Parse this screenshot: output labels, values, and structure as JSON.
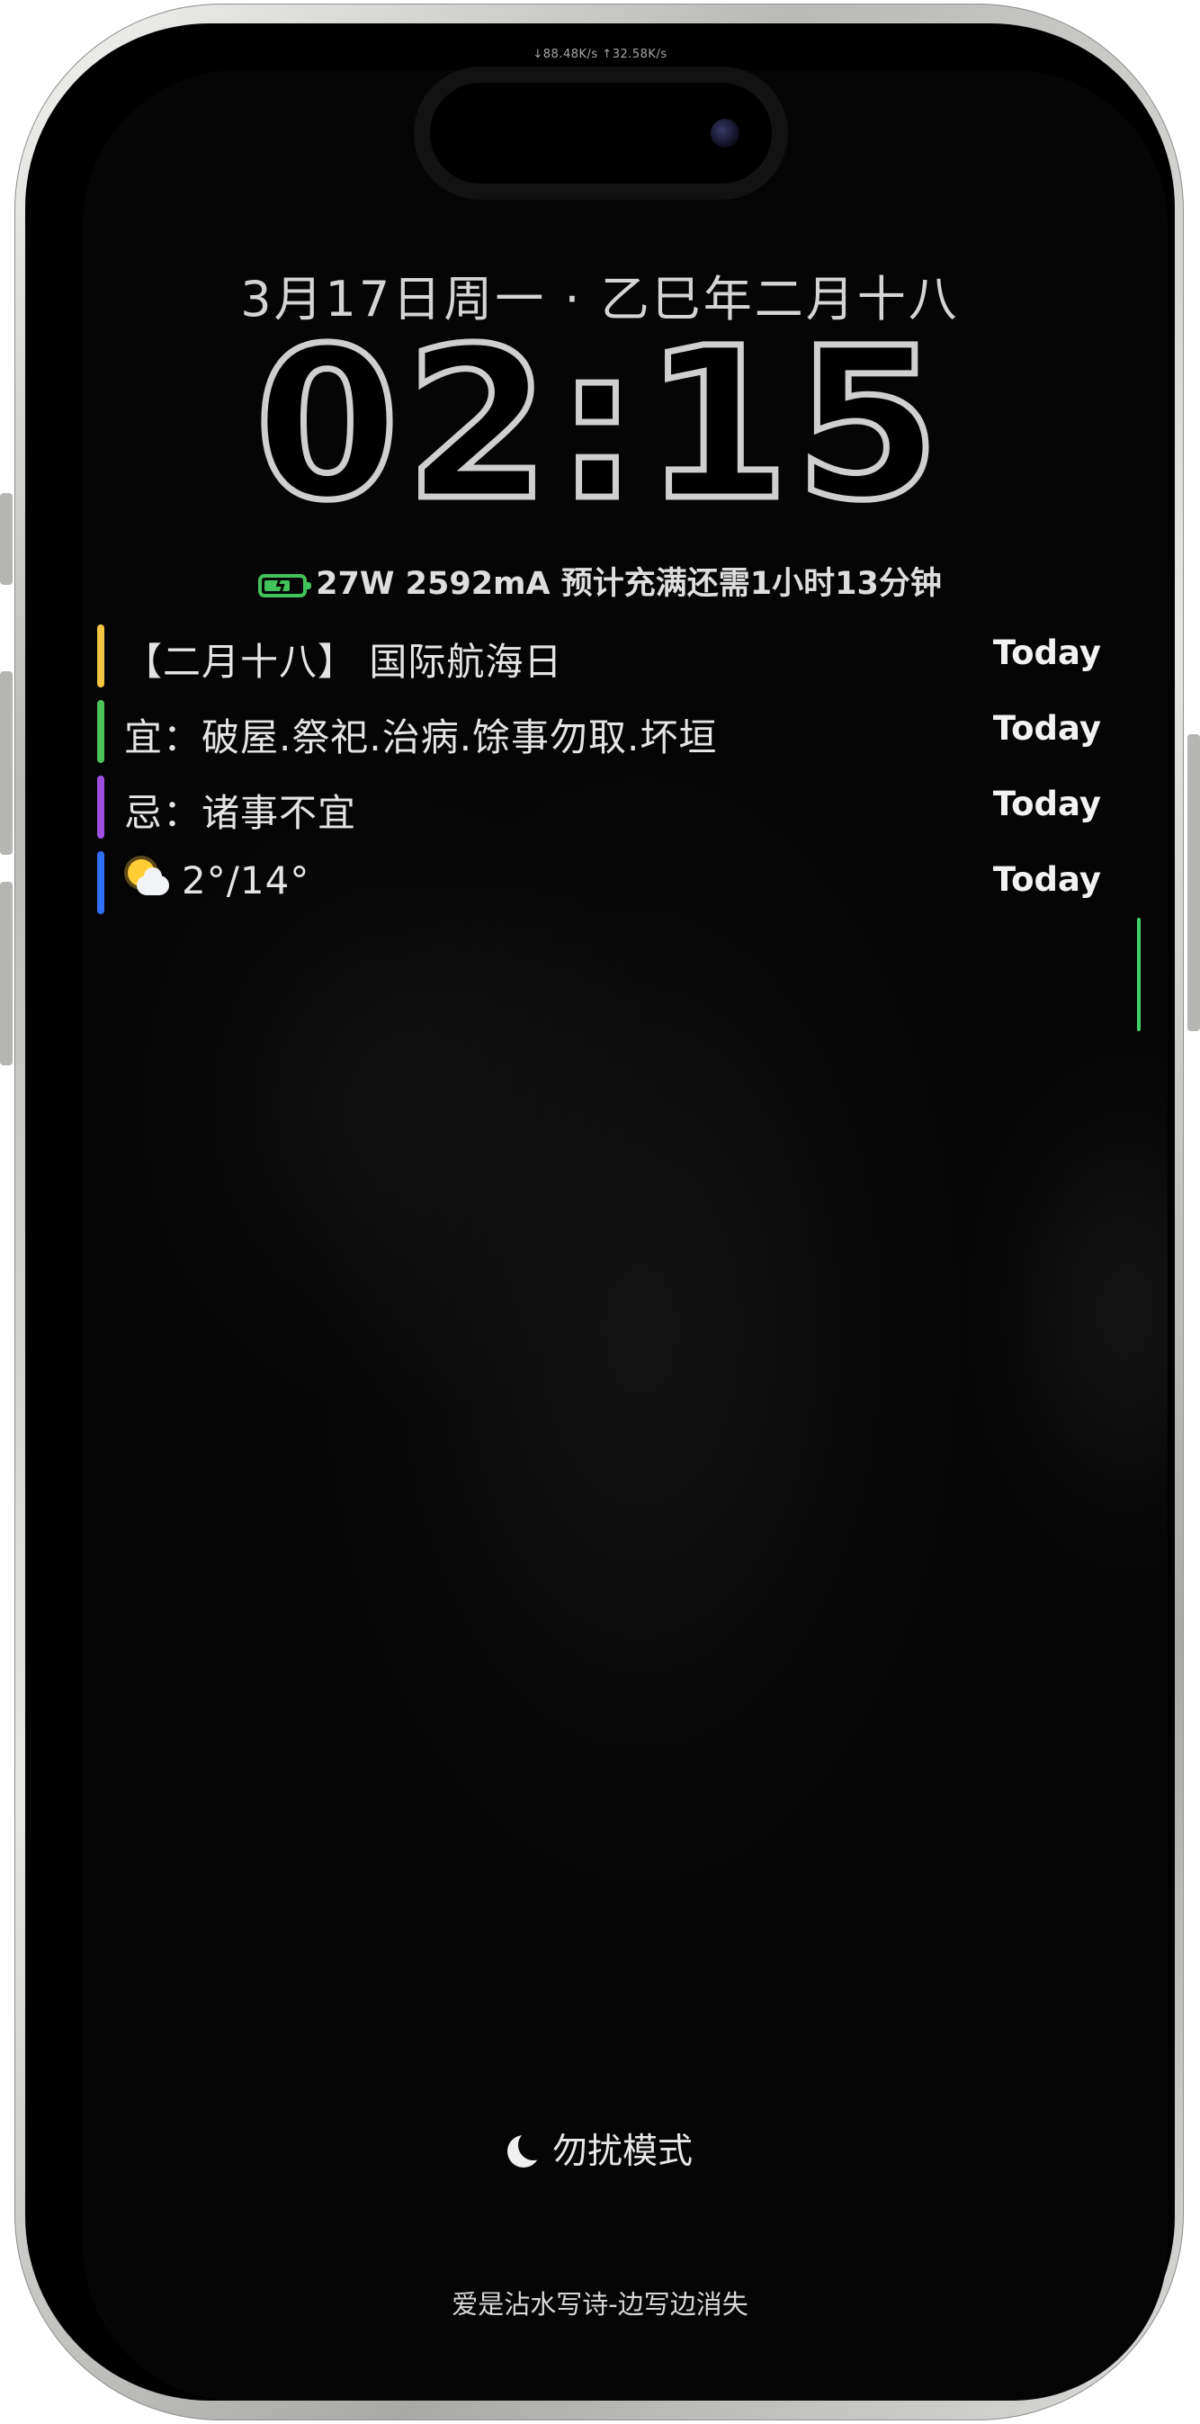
{
  "status": {
    "net_speed": "↓88.48K/s ↑32.58K/s"
  },
  "lockscreen": {
    "date": "3月17日周一 · 乙巳年二月十八",
    "time": "02:15",
    "charging": {
      "text": "27W 2592mA 预计充满还需1小时13分钟",
      "icon": "charging-battery-icon",
      "color": "#41c25a"
    }
  },
  "events": [
    {
      "text": "【二月十八】 国际航海日",
      "when": "Today",
      "color": "#f4c542"
    },
    {
      "text": "宜：破屋.祭祀.治病.馀事勿取.坏垣",
      "when": "Today",
      "color": "#4cc45a"
    },
    {
      "text": "忌：诸事不宜",
      "when": "Today",
      "color": "#a04fe0"
    },
    {
      "text": "2°/14°",
      "when": "Today",
      "color": "#2f6ff2",
      "icon": "sun-behind-cloud-icon"
    }
  ],
  "focus": {
    "label": "勿扰模式",
    "icon": "moon-icon"
  },
  "footer": {
    "caption": "爱是沾水写诗-边写边消失"
  }
}
